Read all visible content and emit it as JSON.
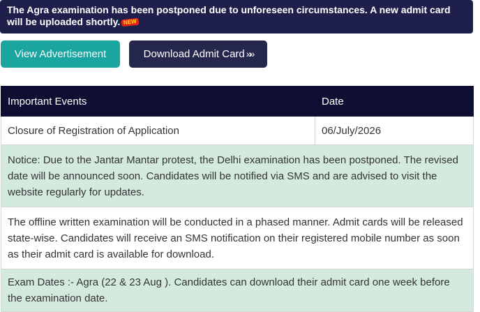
{
  "banner": {
    "text": "The Agra examination has been postponed due to unforeseen circumstances. A new admit card will be uploaded shortly.",
    "badge": "NEW"
  },
  "buttons": {
    "view_advertisement": "View Advertisement",
    "download_admit_card": "Download Admit Card",
    "download_icon": "»»"
  },
  "table": {
    "headers": [
      "Important Events",
      "Date"
    ],
    "registration": {
      "event": "Closure of Registration of Application",
      "date": "06/July/2026"
    },
    "notice": "Notice: Due to the Jantar Mantar protest, the Delhi examination has been postponed. The revised date will be announced soon. Candidates will be notified via SMS and are advised to visit the website regularly for updates.",
    "offline": "The offline written examination will be conducted in a phased manner. Admit cards will be released state-wise. Candidates will receive an SMS notification on their registered mobile number as soon as their admit card is available for download.",
    "exam_dates": "Exam Dates :- Agra (22 & 23 Aug ). Candidates can download their admit card one week before the examination date."
  }
}
